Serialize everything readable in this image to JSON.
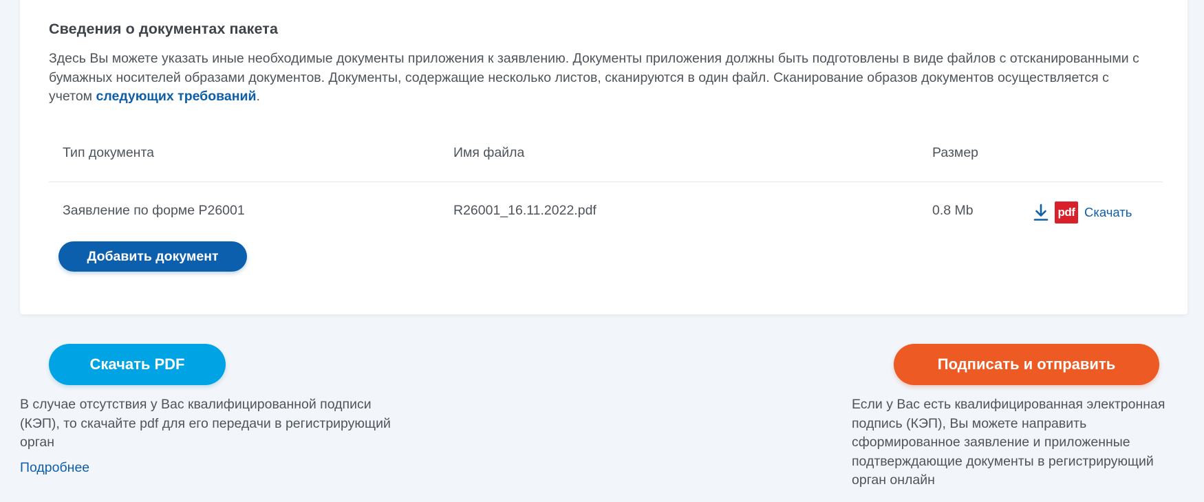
{
  "section": {
    "title": "Сведения о документах пакета",
    "description_text": "Здесь Вы можете указать иные необходимые документы приложения к заявлению. Документы приложения должны быть подготовлены в виде файлов с отсканированными с бумажных носителей образами документов. Документы, содержащие несколько листов, сканируются в один файл. Сканирование образов документов осуществляется с учетом ",
    "description_link": "следующих требований",
    "description_end": "."
  },
  "table": {
    "headers": {
      "doc_type": "Тип документа",
      "file_name": "Имя файла",
      "size": "Размер"
    },
    "rows": [
      {
        "doc_type": "Заявление по форме Р26001",
        "file_name": "R26001_16.11.2022.pdf",
        "size": "0.8 Mb",
        "file_badge": "pdf",
        "download_label": "Скачать"
      }
    ]
  },
  "buttons": {
    "add_document": "Добавить документ",
    "download_pdf": "Скачать PDF",
    "sign_and_send": "Подписать и отправить"
  },
  "notes": {
    "left": "В случае отсутствия у Вас квалифицированной подписи (КЭП), то скачайте pdf для его передачи в регистрирующий орган",
    "left_link": "Подробнее",
    "right": "Если у Вас есть квалифицированная электронная подпись (КЭП), Вы можете направить сформированное заявление и приложенные подтверждающие документы в регистрирующий орган онлайн"
  },
  "icons": {
    "download": "download-icon",
    "pdf": "pdf-file-icon"
  },
  "colors": {
    "page_bg": "#f2f5f9",
    "link": "#0e5ea8",
    "primary_button": "#0c5fac",
    "pdf_button": "#00a4e4",
    "sign_button": "#ee5a24",
    "pdf_badge": "#d9212b"
  }
}
